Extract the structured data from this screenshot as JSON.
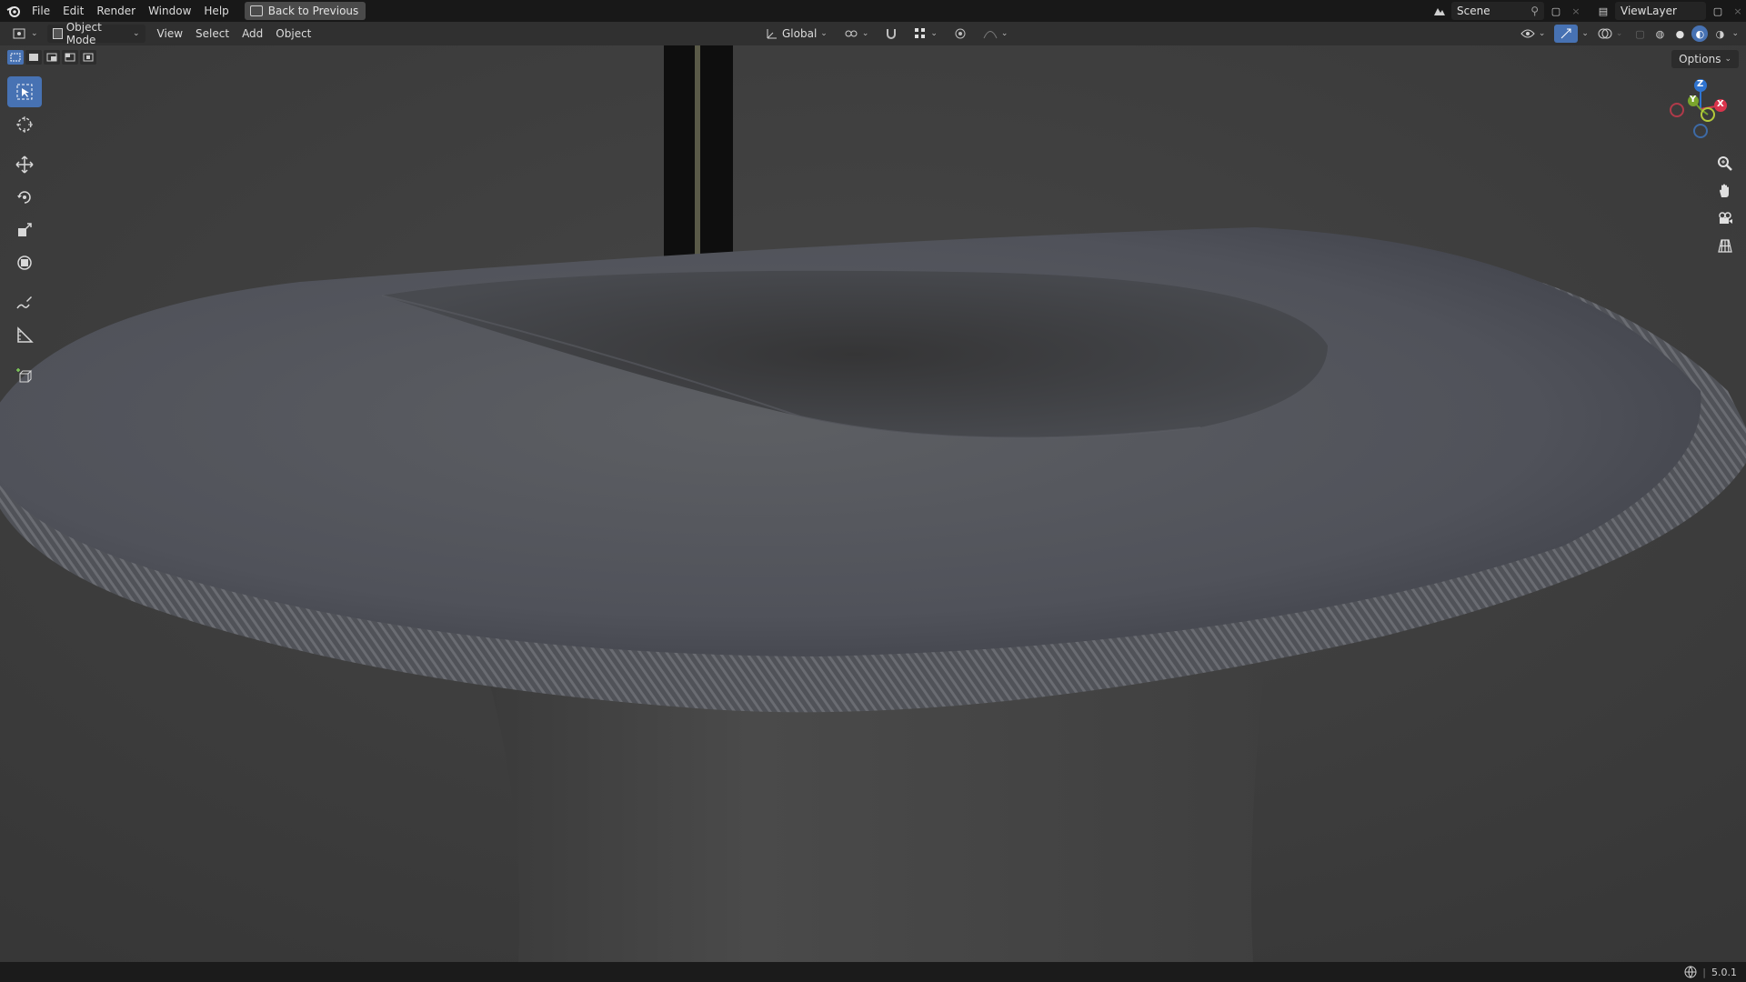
{
  "app": {
    "logo_icon": "blender-logo-icon"
  },
  "menu": {
    "items": [
      "File",
      "Edit",
      "Render",
      "Window",
      "Help"
    ],
    "back_button": "Back to Previous"
  },
  "top_right": {
    "scene": "Scene",
    "view_layer": "ViewLayer"
  },
  "header": {
    "mode": "Object Mode",
    "menus": [
      "View",
      "Select",
      "Add",
      "Object"
    ],
    "transform_orientation": "Global",
    "options": "Options"
  },
  "status": {
    "version": "5.0.1"
  },
  "gizmo": {
    "axes": [
      {
        "label": "Z",
        "color": "#2f74d0"
      },
      {
        "label": "Y",
        "color": "#7aa52c"
      },
      {
        "label": "X",
        "color": "#d9344c"
      }
    ]
  },
  "colors": {
    "accent": "#4772b3",
    "background": "#404040"
  }
}
